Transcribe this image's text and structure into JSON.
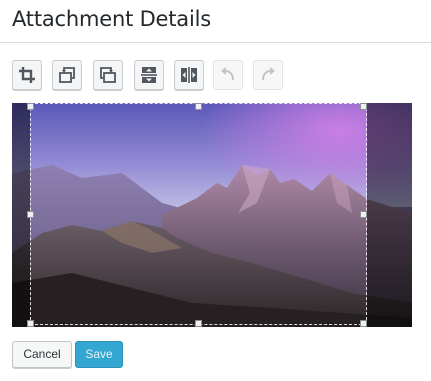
{
  "header": {
    "title": "Attachment Details"
  },
  "toolbar": {
    "buttons": [
      {
        "icon": "crop-icon",
        "label": "Crop",
        "enabled": true
      },
      {
        "icon": "rotate-left-icon",
        "label": "Rotate left",
        "enabled": true
      },
      {
        "icon": "rotate-right-icon",
        "label": "Rotate right",
        "enabled": true
      },
      {
        "icon": "flip-vertical-icon",
        "label": "Flip vertical",
        "enabled": true
      },
      {
        "icon": "flip-horizontal-icon",
        "label": "Flip horizontal",
        "enabled": true
      },
      {
        "icon": "undo-icon",
        "label": "Undo",
        "enabled": false
      },
      {
        "icon": "redo-icon",
        "label": "Redo",
        "enabled": false
      }
    ]
  },
  "image": {
    "subject": "mountain-landscape-photo"
  },
  "actions": {
    "cancel_label": "Cancel",
    "save_label": "Save"
  },
  "colors": {
    "save_button": "#33a6d1",
    "sky_purple": "#a679d6"
  }
}
